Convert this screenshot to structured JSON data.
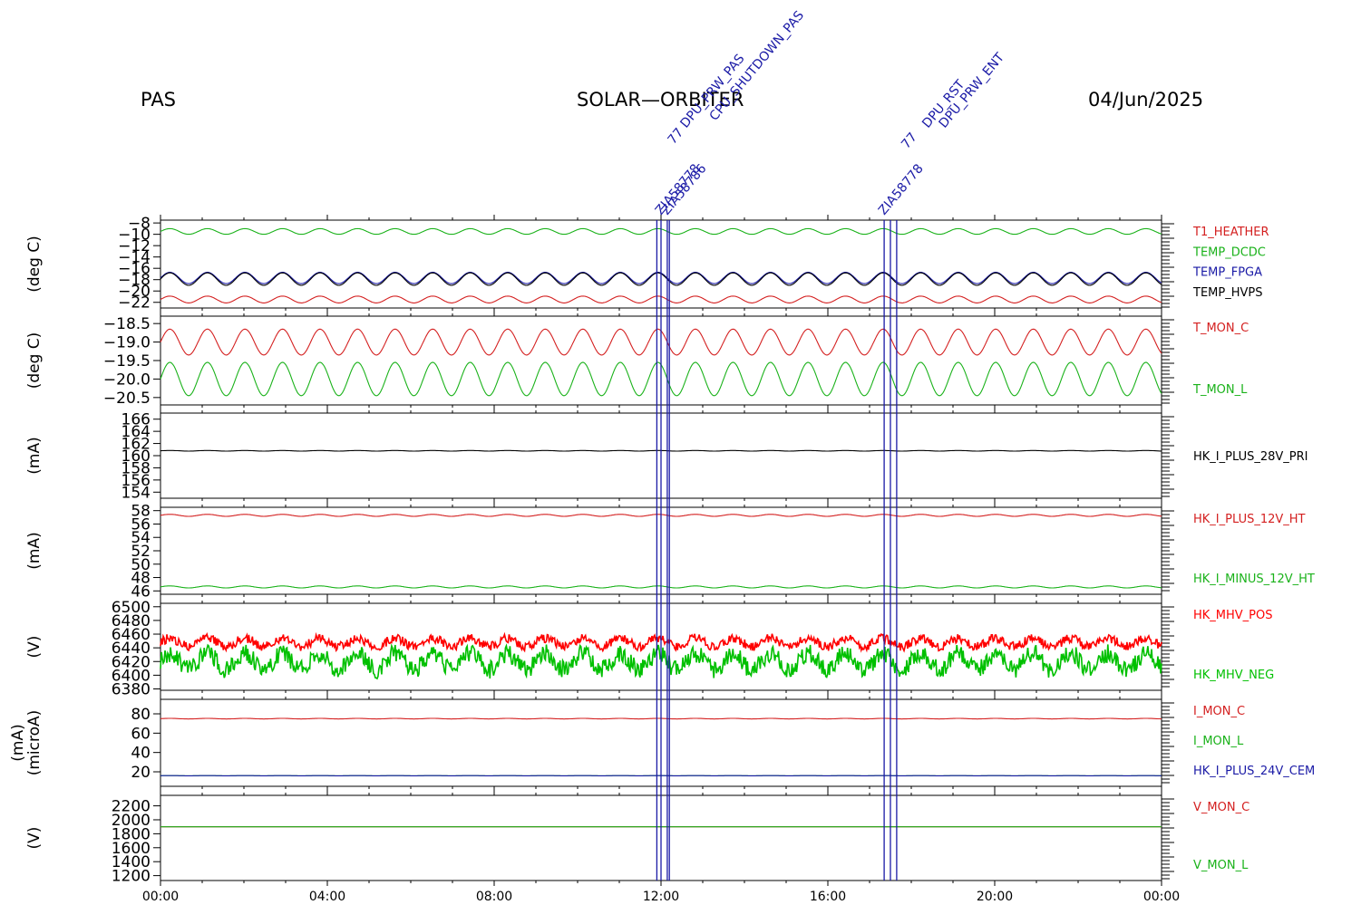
{
  "header": {
    "instrument": "PAS",
    "mission": "SOLAR—ORBITER",
    "date": "04/Jun/2025"
  },
  "colors": {
    "red": "#d42020",
    "green": "#1ab21a",
    "blue": "#1a1aa6",
    "black": "#000000",
    "bright_green": "#00c000",
    "bright_red": "#ff0000"
  },
  "chart_data": {
    "type": "line",
    "x_unit": "hours",
    "xlim": [
      0,
      24
    ],
    "x_ticks": [
      "00:00",
      "04:00",
      "08:00",
      "12:00",
      "16:00",
      "20:00",
      "00:00"
    ],
    "event_lines_hours": [
      11.9,
      12.0,
      12.15,
      12.2,
      17.35,
      17.5,
      17.65
    ],
    "event_labels": [
      "ZIA58778",
      "ZIA58786",
      "77",
      "DPU_PRW_PAS",
      "CPU_SHUTDOWN_PAS",
      "ZIA58778",
      "77",
      "DPU_RST",
      "DPU_PRW_ENT"
    ],
    "panels": [
      {
        "ylabel": "(deg C)",
        "ylim": [
          -23,
          -7.5
        ],
        "yticks": [
          "-8",
          "-10",
          "-12",
          "-14",
          "-16",
          "-18",
          "-20",
          "-22"
        ],
        "series": [
          {
            "name": "T1_HEATHER",
            "color": "red",
            "base": -21.5,
            "amp": 0.6,
            "period_h": 0.9
          },
          {
            "name": "TEMP_DCDC",
            "color": "green",
            "base": -9.5,
            "amp": 0.5,
            "period_h": 0.9
          },
          {
            "name": "TEMP_FPGA",
            "color": "blue",
            "base": -17.7,
            "amp": 1.0,
            "period_h": 0.9
          },
          {
            "name": "TEMP_HVPS",
            "color": "black",
            "base": -17.9,
            "amp": 1.1,
            "period_h": 0.9
          }
        ]
      },
      {
        "ylabel": "(deg C)",
        "ylim": [
          -20.7,
          -18.3
        ],
        "yticks": [
          "-18.5",
          "-19.0",
          "-19.5",
          "-20.0",
          "-20.5"
        ],
        "series": [
          {
            "name": "T_MON_C",
            "color": "red",
            "base": -19.0,
            "amp": 0.35,
            "period_h": 0.9
          },
          {
            "name": "T_MON_L",
            "color": "green",
            "base": -20.0,
            "amp": 0.45,
            "period_h": 0.9
          }
        ]
      },
      {
        "ylabel": "(mA)",
        "ylim": [
          153,
          167
        ],
        "yticks": [
          "166",
          "164",
          "162",
          "160",
          "158",
          "156",
          "154"
        ],
        "series": [
          {
            "name": "HK_I_PLUS_28V_PRI",
            "color": "black",
            "base": 160.8,
            "amp": 0.05,
            "period_h": 0.9
          }
        ]
      },
      {
        "ylabel": "(mA)",
        "ylim": [
          45.5,
          58.5
        ],
        "yticks": [
          "58",
          "56",
          "54",
          "52",
          "50",
          "48",
          "46"
        ],
        "series": [
          {
            "name": "HK_I_PLUS_12V_HT",
            "color": "red",
            "base": 57.3,
            "amp": 0.15,
            "period_h": 0.9
          },
          {
            "name": "HK_I_MINUS_12V_HT",
            "color": "green",
            "base": 46.6,
            "amp": 0.15,
            "period_h": 0.9
          }
        ]
      },
      {
        "ylabel": "(V)",
        "ylim": [
          6378,
          6505
        ],
        "yticks": [
          "6500",
          "6480",
          "6460",
          "6440",
          "6420",
          "6400",
          "6380"
        ],
        "series": [
          {
            "name": "HK_MHV_POS",
            "color": "bright_red",
            "base": 6448,
            "amp": 6,
            "period_h": 0.9
          },
          {
            "name": "HK_MHV_NEG",
            "color": "bright_green",
            "base": 6420,
            "amp": 12,
            "period_h": 0.9
          }
        ]
      },
      {
        "ylabel": "(microA)",
        "ylabel2": "(mA)",
        "ylim": [
          5,
          95
        ],
        "yticks": [
          "80",
          "60",
          "40",
          "20"
        ],
        "series": [
          {
            "name": "I_MON_C",
            "color": "red",
            "base": 75,
            "amp": 0.3,
            "period_h": 0.9
          },
          {
            "name": "I_MON_L",
            "color": "green",
            "base": 16,
            "amp": 0.1,
            "period_h": 0.9
          },
          {
            "name": "HK_I_PLUS_24V_CEM",
            "color": "blue",
            "base": 16,
            "amp": 0.1,
            "period_h": 0.9
          }
        ]
      },
      {
        "ylabel": "(V)",
        "ylim": [
          1130,
          2350
        ],
        "yticks": [
          "2200",
          "2000",
          "1800",
          "1600",
          "1400",
          "1200"
        ],
        "series": [
          {
            "name": "V_MON_C",
            "color": "red",
            "base": 1900,
            "amp": 0,
            "period_h": 0.9
          },
          {
            "name": "V_MON_L",
            "color": "green",
            "base": 1900,
            "amp": 0,
            "period_h": 0.9
          }
        ]
      }
    ]
  }
}
